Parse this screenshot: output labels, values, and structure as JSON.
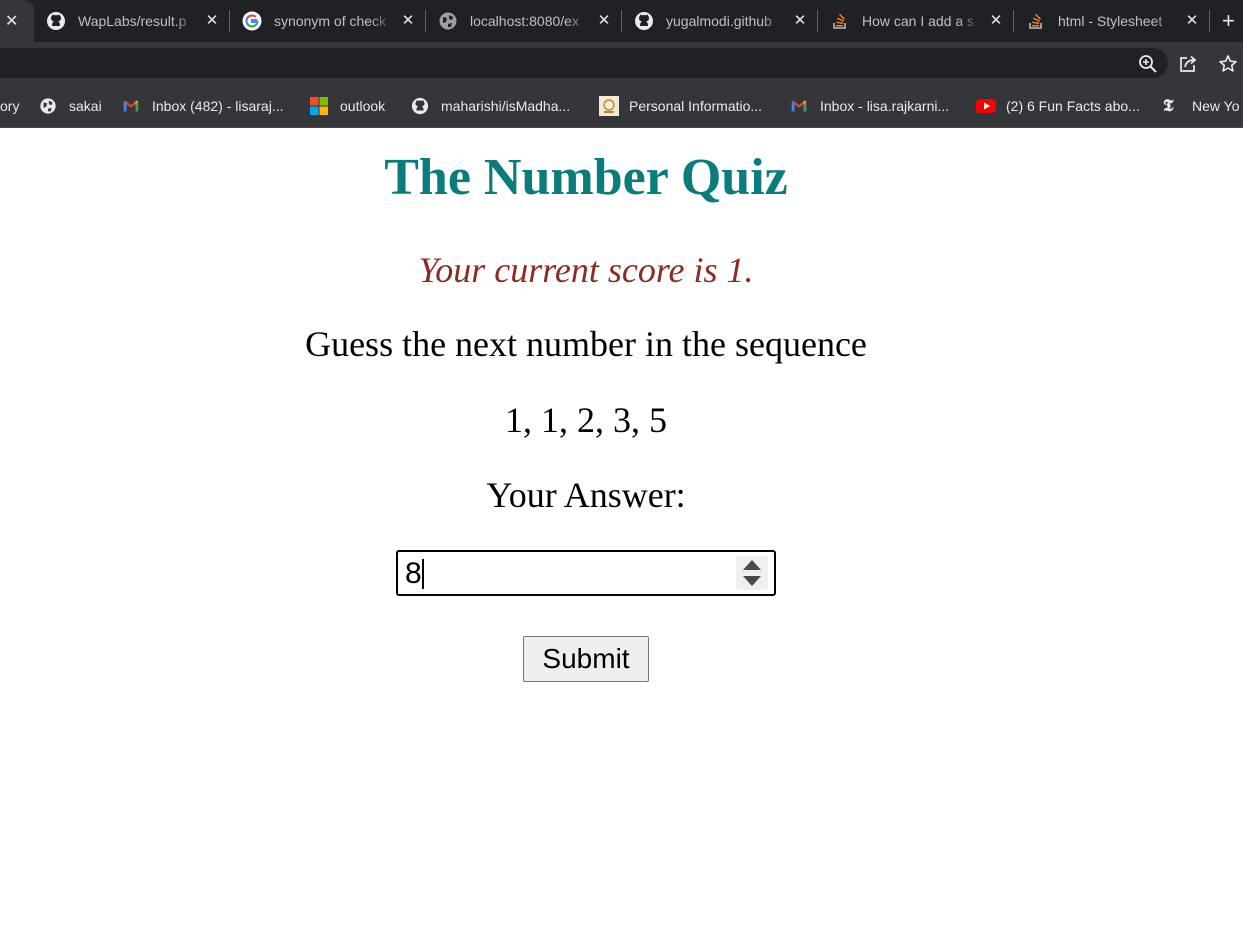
{
  "browser": {
    "tabs": [
      {
        "title": "WapLabs/result.p",
        "favicon": "github-icon"
      },
      {
        "title": "synonym of check",
        "favicon": "google-icon"
      },
      {
        "title": "localhost:8080/ex",
        "favicon": "globe-icon"
      },
      {
        "title": "yugalmodi.github",
        "favicon": "github-icon"
      },
      {
        "title": "How can I add a s",
        "favicon": "stackoverflow-icon"
      },
      {
        "title": "html - Stylesheet",
        "favicon": "stackoverflow-icon"
      }
    ],
    "first_tab_close": "✕",
    "new_tab": "+",
    "toolbar_icons": [
      "zoom-icon",
      "share-icon",
      "star-icon"
    ],
    "bookmarks": [
      {
        "label": "ory",
        "icon": ""
      },
      {
        "label": "sakai",
        "icon": "globe-icon"
      },
      {
        "label": "Inbox (482) - lisaraj...",
        "icon": "gmail-icon"
      },
      {
        "label": "outlook",
        "icon": "microsoft-icon"
      },
      {
        "label": "maharishi/isMadha...",
        "icon": "github-icon"
      },
      {
        "label": "Personal Informatio...",
        "icon": "university-icon"
      },
      {
        "label": "Inbox - lisa.rajkarni...",
        "icon": "gmail-icon"
      },
      {
        "label": "(2) 6 Fun Facts abo...",
        "icon": "youtube-icon"
      },
      {
        "label": "New Yo",
        "icon": "nytimes-icon"
      }
    ],
    "colors": {
      "tabstrip": "#202124",
      "toolbar": "#35363a",
      "text": "#e8eaed"
    }
  },
  "quiz": {
    "title": "The Number Quiz",
    "score_text": "Your current score is 1.",
    "prompt": "Guess the next number in the sequence",
    "sequence": "1, 1, 2, 3, 5",
    "answer_label": "Your Answer:",
    "answer_value": "8",
    "submit_label": "Submit",
    "colors": {
      "title": "#0a7c7c",
      "score": "#8b2b22"
    }
  }
}
